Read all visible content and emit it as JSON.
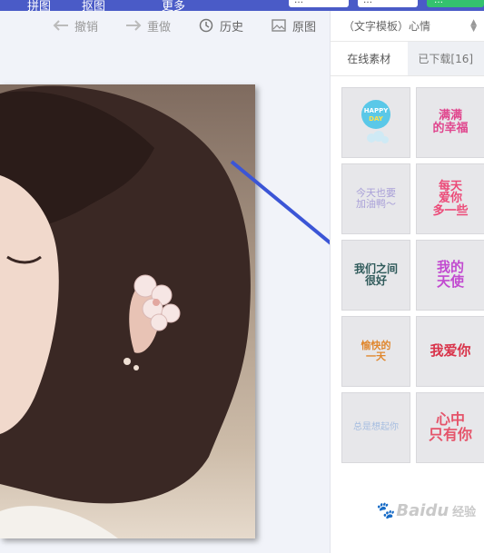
{
  "topbar": {
    "menu": [
      "拼图",
      "抠图",
      "更多"
    ],
    "buttons": [
      "…",
      "…"
    ],
    "primary": "…"
  },
  "toolbar": {
    "undo": "撤销",
    "redo": "重做",
    "history": "历史",
    "original": "原图"
  },
  "panel": {
    "category": "（文字模板）心情",
    "tabs": {
      "online": "在线素材",
      "downloaded": "已下载[16]"
    },
    "stickers": [
      {
        "text": "HAPPY DAY",
        "color": "#39a9d9"
      },
      {
        "text": "满满的幸福",
        "color": "#e0458d"
      },
      {
        "text": "今天也要加油",
        "color": "#a9a0d8"
      },
      {
        "text": "每天爱你多一些",
        "color": "#ec4a78"
      },
      {
        "text": "我们之间",
        "color": "#2f5a5a"
      },
      {
        "text": "我的天使",
        "color": "#c24ad0"
      },
      {
        "text": "愉快的一天",
        "color": "#e0872e"
      },
      {
        "text": "我爱你",
        "color": "#d9334a"
      },
      {
        "text": "总是想起你",
        "color": "#a6bde0"
      },
      {
        "text": "心中只有你",
        "color": "#e5546a"
      }
    ]
  },
  "watermark": {
    "brand": "Baidu",
    "sub": "经验"
  },
  "colors": {
    "accent": "#4a5bc7",
    "arrow": "#3b55d6",
    "primary_button": "#34c26e"
  }
}
